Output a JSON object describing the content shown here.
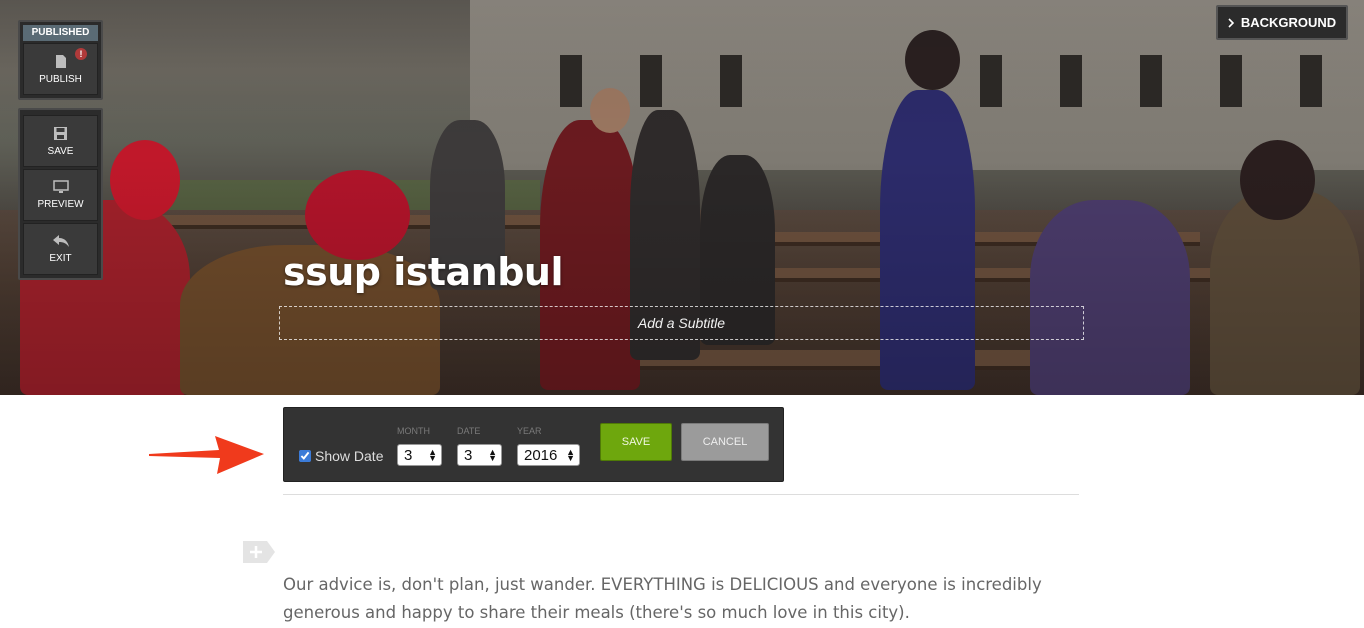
{
  "toolbar": {
    "publish_status": "PUBLISHED",
    "publish_label": "PUBLISH",
    "publish_alert": "!",
    "save_label": "SAVE",
    "preview_label": "PREVIEW",
    "exit_label": "EXIT"
  },
  "background_button": {
    "label": "BACKGROUND"
  },
  "post": {
    "title": "ssup istanbul",
    "subtitle_placeholder": "Add a Subtitle",
    "body": "Our advice is, don't plan, just wander. EVERYTHING is DELICIOUS and everyone is incredibly generous and happy to share their meals (there's so much love in this city)."
  },
  "date_panel": {
    "show_date_label": "Show Date",
    "show_date_checked": true,
    "month_label": "MONTH",
    "month_value": "3",
    "date_label": "DATE",
    "date_value": "3",
    "year_label": "YEAR",
    "year_value": "2016",
    "save_label": "SAVE",
    "cancel_label": "CANCEL"
  },
  "colors": {
    "save_green": "#6ea70d",
    "annotation_arrow": "#f03a1c",
    "toolbar_dark": "#2b2b2b"
  },
  "icons": [
    "document-icon",
    "floppy-disk-icon",
    "monitor-icon",
    "undo-arrow-icon",
    "chevron-right-icon",
    "plus-tag-icon"
  ]
}
